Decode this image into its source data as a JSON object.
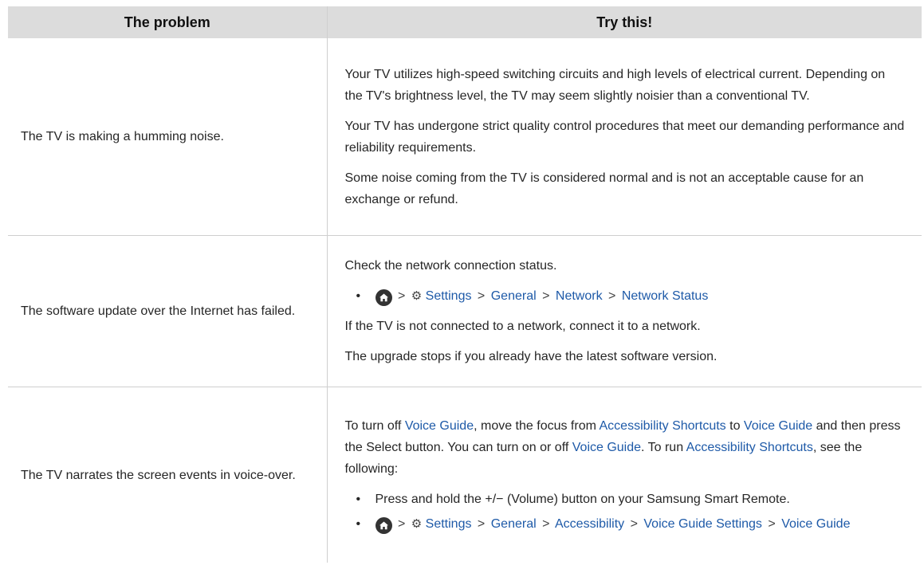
{
  "header": {
    "problem": "The problem",
    "try_this": "Try this!"
  },
  "rows": [
    {
      "problem": "The TV is making a humming noise.",
      "p1": "Your TV utilizes high-speed switching circuits and high levels of electrical current. Depending on the TV's brightness level, the TV may seem slightly noisier than a conventional TV.",
      "p2": "Your TV has undergone strict quality control procedures that meet our demanding performance and reliability requirements.",
      "p3": "Some noise coming from the TV is considered normal and is not an acceptable cause for an exchange or refund."
    },
    {
      "problem": "The software update over the Internet has failed.",
      "p1": "Check the network connection status.",
      "path": [
        "Settings",
        "General",
        "Network",
        "Network Status"
      ],
      "p2": "If the TV is not connected to a network, connect it to a network.",
      "p3": "The upgrade stops if you already have the latest software version."
    },
    {
      "problem": "The TV narrates the screen events in voice-over.",
      "t1": "To turn off ",
      "l1": "Voice Guide",
      "t2": ", move the focus from ",
      "l2": "Accessibility Shortcuts",
      "t3": " to ",
      "l3": "Voice Guide",
      "t4": " and then press the Select button. You can turn on or off ",
      "l4": "Voice Guide",
      "t5": ". To run ",
      "l5": "Accessibility Shortcuts",
      "t6": ", see the following:",
      "b1_a": "Press and hold the ",
      "b1_sym": "+/−",
      "b1_b": " (Volume) button on your Samsung Smart Remote.",
      "path": [
        "Settings",
        "General",
        "Accessibility",
        "Voice Guide Settings",
        "Voice Guide"
      ]
    }
  ],
  "icons": {
    "bullet": "•",
    "separator": ">",
    "home": "home-icon",
    "settings": "gear-icon"
  },
  "colors": {
    "link": "#1e5aa8",
    "header_bg": "#dcdcdc",
    "border": "#cfcfcf"
  }
}
